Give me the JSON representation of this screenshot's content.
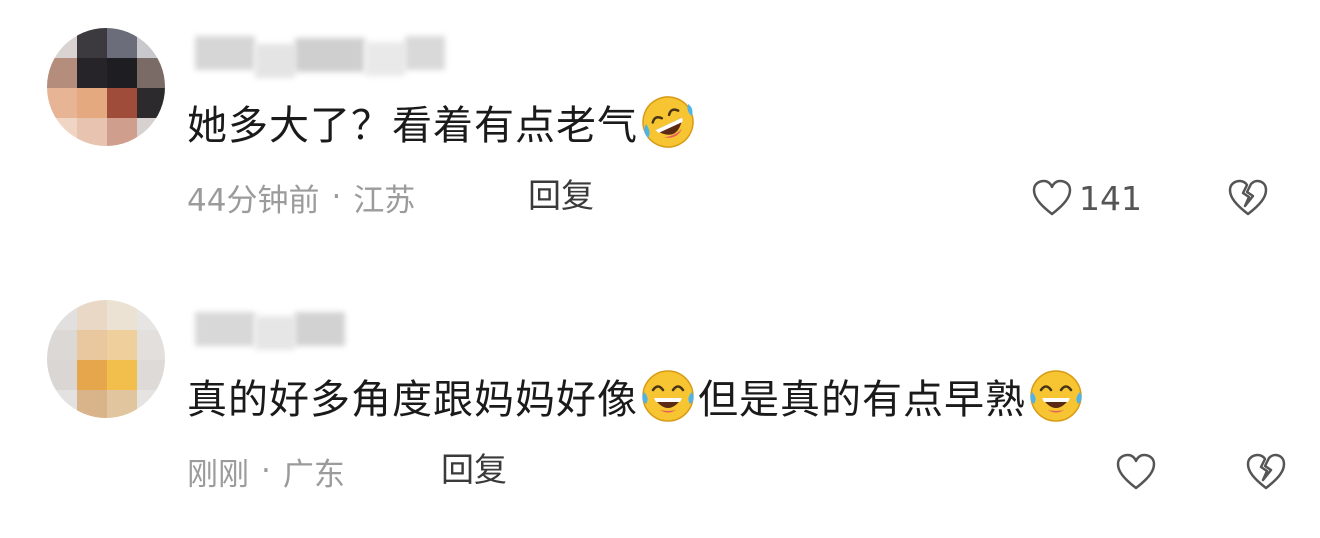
{
  "comments": [
    {
      "username": "",
      "text_part1": "她多大了？看着有点老气",
      "emoji_after_part1": "rolling-laughing-emoji",
      "text_part2": "",
      "emoji_after_part2": "",
      "time": "44分钟前",
      "separator": "·",
      "location": "江苏",
      "reply_label": "回复",
      "like_count": "141",
      "like_icon": "heart-outline-icon",
      "dislike_icon": "broken-heart-icon"
    },
    {
      "username": "",
      "text_part1": "真的好多角度跟妈妈好像",
      "emoji_after_part1": "tears-of-joy-emoji",
      "text_part2": "但是真的有点早熟",
      "emoji_after_part2": "tears-of-joy-emoji",
      "time": "刚刚",
      "separator": "·",
      "location": "广东",
      "reply_label": "回复",
      "like_count": "",
      "like_icon": "heart-outline-icon",
      "dislike_icon": "broken-heart-icon"
    }
  ],
  "colors": {
    "text_primary": "#1a1a1a",
    "text_meta": "#9b9b9b",
    "reply": "#3a3a3a",
    "icon_stroke": "#555555",
    "emoji_yellow": "#f6c531"
  }
}
